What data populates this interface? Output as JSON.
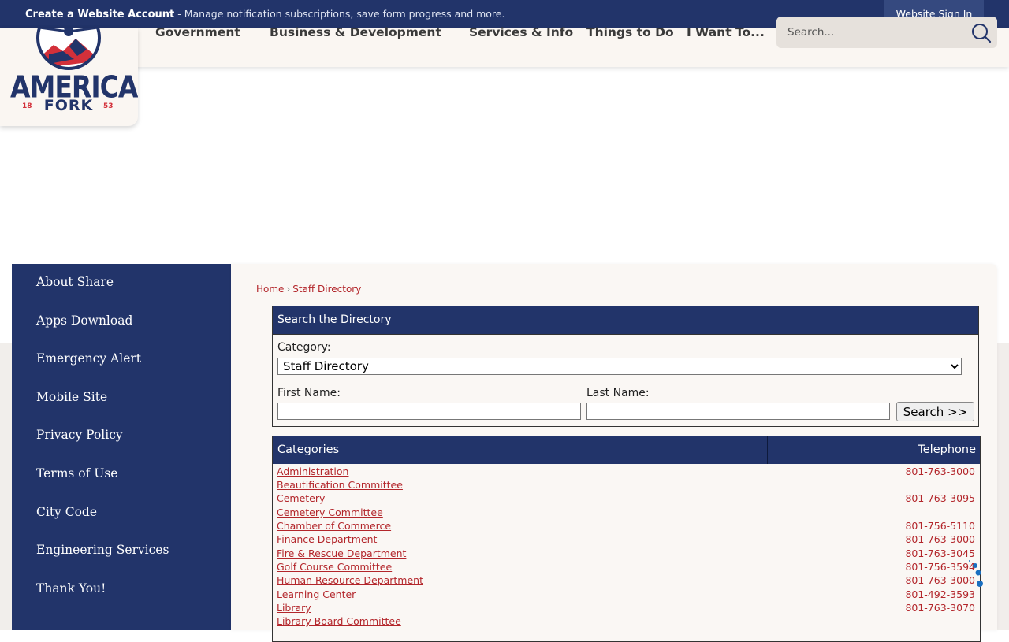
{
  "topbar": {
    "account_link": "Create a Website Account",
    "account_desc": " - Manage notification subscriptions, save form progress and more.",
    "signin": "Website Sign In"
  },
  "logo": {
    "text_main": "AMERICAN",
    "text_sub": "FORK",
    "year_left": "18",
    "year_right": "53"
  },
  "nav": {
    "items": [
      {
        "label": "Government"
      },
      {
        "label": "Business & Development"
      },
      {
        "label": "Services & Info"
      },
      {
        "label": "Things to Do"
      },
      {
        "label": "I Want To..."
      }
    ],
    "search_placeholder": "Search..."
  },
  "sidebar": {
    "items": [
      {
        "label": "About Share"
      },
      {
        "label": "Apps Download"
      },
      {
        "label": "Emergency Alert"
      },
      {
        "label": "Mobile Site"
      },
      {
        "label": "Privacy Policy"
      },
      {
        "label": "Terms of Use"
      },
      {
        "label": "City Code"
      },
      {
        "label": "Engineering Services"
      },
      {
        "label": "Thank You!"
      }
    ]
  },
  "breadcrumb": {
    "home": "Home",
    "separator": "›",
    "current": "Staff Directory"
  },
  "search_directory": {
    "title": "Search the Directory",
    "category_label": "Category:",
    "category_selected": "Staff Directory",
    "first_name_label": "First Name:",
    "last_name_label": "Last Name:",
    "search_button": "Search >>"
  },
  "directory_table": {
    "headers": {
      "categories": "Categories",
      "telephone": "Telephone"
    },
    "rows": [
      {
        "name": "Administration",
        "phone": "801-763-3000"
      },
      {
        "name": "Beautification Committee",
        "phone": ""
      },
      {
        "name": "Cemetery",
        "phone": "801-763-3095"
      },
      {
        "name": "Cemetery Committee",
        "phone": ""
      },
      {
        "name": "Chamber of Commerce",
        "phone": "801-756-5110"
      },
      {
        "name": "Finance Department",
        "phone": "801-763-3000"
      },
      {
        "name": "Fire & Rescue Department",
        "phone": "801-763-3045"
      },
      {
        "name": "Golf Course Committee",
        "phone": "801-756-3594"
      },
      {
        "name": "Human Resource Department",
        "phone": "801-763-3000"
      },
      {
        "name": "Learning Center",
        "phone": "801-492-3593"
      },
      {
        "name": "Library",
        "phone": "801-763-3070"
      },
      {
        "name": "Library Board Committee",
        "phone": ""
      }
    ]
  },
  "colors": {
    "navy": "#22346a",
    "accent_red": "#b3262b",
    "header_bg": "#faf6f2"
  }
}
